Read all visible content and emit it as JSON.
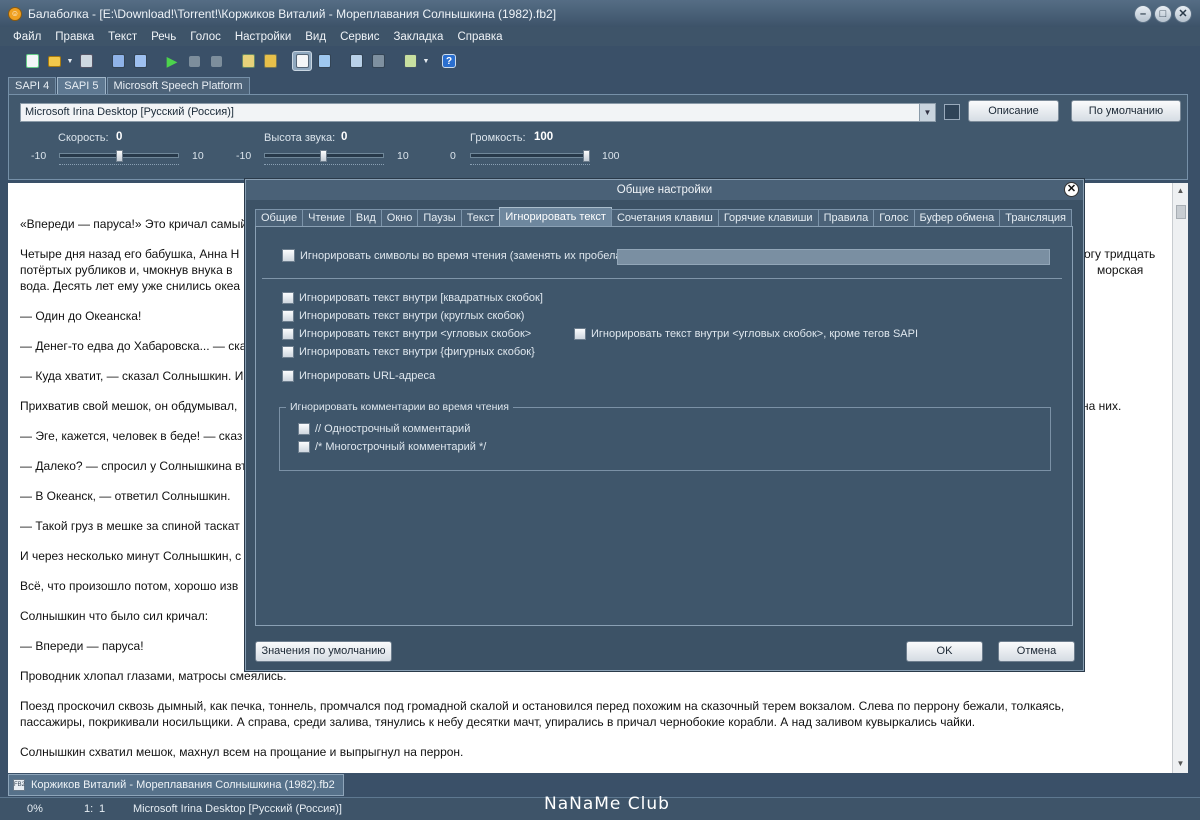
{
  "window": {
    "title": "Балаболка - [E:\\Download!\\Torrent!\\Коржиков Виталий - Мореплавания Солнышкина (1982).fb2]",
    "controls": [
      "minimize",
      "maximize",
      "close"
    ]
  },
  "menu": [
    "Файл",
    "Правка",
    "Текст",
    "Речь",
    "Голос",
    "Настройки",
    "Вид",
    "Сервис",
    "Закладка",
    "Справка"
  ],
  "toolbar": {
    "icons": [
      "new-file-icon",
      "open-folder-icon",
      "dropdown-arrow-icon",
      "save-icon",
      "save-as-audio-icon",
      "split-audio-icon",
      "play-icon",
      "pause-icon",
      "stop-icon",
      "read-clipboard-icon",
      "read-files-icon",
      "settings-icon",
      "voices-icon",
      "convert-icon",
      "batch-icon",
      "export-icon",
      "dropdown-arrow-icon",
      "help-icon"
    ]
  },
  "sapi_tabs": [
    "SAPI 4",
    "SAPI 5",
    "Microsoft Speech Platform"
  ],
  "voice": {
    "selected": "Microsoft Irina Desktop [Русский (Россия)]",
    "description_button": "Описание",
    "default_button": "По умолчанию"
  },
  "sliders": {
    "rate": {
      "label": "Скорость:",
      "value": "0",
      "min": "-10",
      "max": "10",
      "level": 0.5
    },
    "pitch": {
      "label": "Высота звука:",
      "value": "0",
      "min": "-10",
      "max": "10",
      "level": 0.5
    },
    "volume": {
      "label": "Громкость:",
      "value": "100",
      "min": "0",
      "max": "100",
      "level": 1.0
    }
  },
  "document": {
    "lines": [
      "«Впереди — паруса!» Это кричал самый",
      "Четыре дня назад его бабушка, Анна Н",
      "потёртых рубликов и, чмокнув внука в",
      "вода. Десять лет ему уже снились океа",
      "— Один до Океанска!",
      "— Денег-то едва до Хабаровска... — сказ",
      "— Куда хватит, — сказал Солнышкин. И ч",
      "Прихватив свой мешок, он обдумывал,",
      "— Эге, кажется, человек в беде! — сказ",
      "— Далеко? — спросил у Солнышкина вто",
      "— В Океанск, — ответил Солнышкин.",
      "— Такой груз в мешке за спиной таскат",
      "И через несколько минут Солнышкин, с",
      "Всё, что произошло потом, хорошо изв",
      "Солнышкин что было сил кричал:",
      "— Впереди — паруса!",
      "Проводник хлопал глазами, матросы смеялись.",
      "Поезд проскочил сквозь дымный, как печка, тоннель, промчался под громадной скалой и остановился перед похожим на сказочный терем вокзалом. Слева по перрону бежали, толкаясь,",
      "пассажиры, покрикивали носильщики. А справа, среди залива, тянулись к небу десятки мачт, упирались в причал чернобокие корабли. А над заливом кувыркались чайки.",
      "Солнышкин схватил мешок, махнул всем на прощание и выпрыгнул на перрон."
    ],
    "right_fragments": [
      "огу тридцать",
      "морская",
      "на них."
    ]
  },
  "file_tab": "Коржиков Виталий - Мореплавания Солнышкина (1982).fb2",
  "status": {
    "percent": "0%",
    "position_line": "1:",
    "position_col": "1",
    "voice": "Microsoft Irina Desktop [Русский (Россия)]",
    "watermark": "NaNaMe Club"
  },
  "dialog": {
    "title": "Общие настройки",
    "tabs": [
      "Общие",
      "Чтение",
      "Вид",
      "Окно",
      "Паузы",
      "Текст",
      "Игнорировать текст",
      "Сочетания клавиш",
      "Горячие клавиши",
      "Правила",
      "Голос",
      "Буфер обмена",
      "Трансляция"
    ],
    "active_tab": 6,
    "ignore_symbols_label": "Игнорировать символы во время чтения (заменять их пробелами):",
    "ignore_symbols_value": "",
    "options": {
      "square": "Игнорировать текст внутри [квадратных скобок]",
      "round": "Игнорировать текст внутри (круглых скобок)",
      "angle": "Игнорировать текст внутри <угловых скобок>",
      "angle_sapi": "Игнорировать текст внутри <угловых скобок>, кроме тегов SAPI",
      "curly": "Игнорировать текст внутри {фигурных скобок}",
      "url": "Игнорировать URL-адреса"
    },
    "comments_group": {
      "label": "Игнорировать комментарии во время чтения",
      "single": "// Однострочный комментарий",
      "multi": "/* Многострочный комментарий */"
    },
    "defaults_button": "Значения по умолчанию",
    "ok_button": "OK",
    "cancel_button": "Отмена"
  },
  "colors": {
    "accent": "#3a5068",
    "panel": "#3f566b",
    "doc_bg": "#ffffff"
  }
}
